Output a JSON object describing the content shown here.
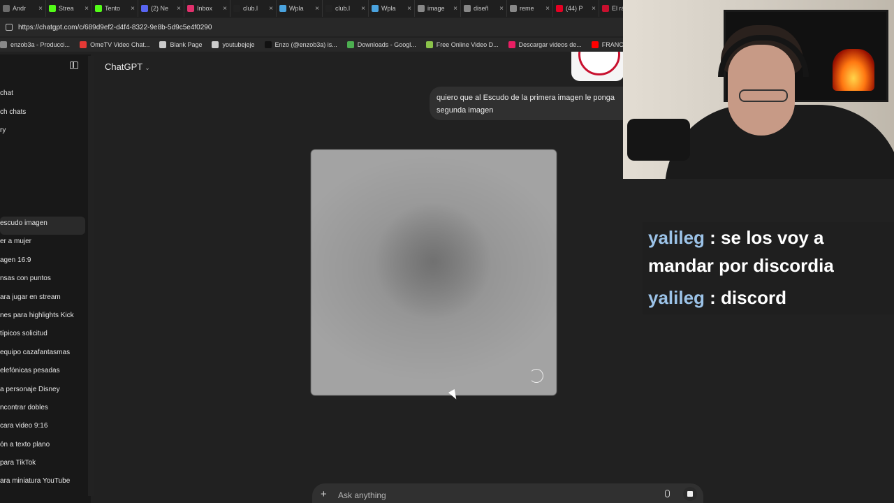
{
  "browser": {
    "tabs": [
      {
        "label": "Andr",
        "color": "#6b6b6b"
      },
      {
        "label": "Strea",
        "color": "#53fc18"
      },
      {
        "label": "Tento",
        "color": "#53fc18"
      },
      {
        "label": "(2) Ne",
        "color": "#5865f2"
      },
      {
        "label": "Inbox",
        "color": "#e1306c"
      },
      {
        "label": "club.l",
        "color": "#222222"
      },
      {
        "label": "Wpla",
        "color": "#4aa3df"
      },
      {
        "label": "club.l",
        "color": "#222222"
      },
      {
        "label": "Wpla",
        "color": "#4aa3df"
      },
      {
        "label": "image",
        "color": "#888888"
      },
      {
        "label": "diseñ",
        "color": "#888888"
      },
      {
        "label": "reme",
        "color": "#888888"
      },
      {
        "label": "(44) P",
        "color": "#e60023"
      },
      {
        "label": "El rá",
        "color": "#c8102e"
      }
    ],
    "url": "https://chatgpt.com/c/689d9ef2-d4f4-8322-9e8b-5d9c5e4f0290",
    "bookmarks": [
      {
        "label": "enzob3a - Producci...",
        "color": "#888888"
      },
      {
        "label": "OmeTV Video Chat...",
        "color": "#e53935"
      },
      {
        "label": "Blank Page",
        "color": "#cccccc"
      },
      {
        "label": "youtubejeje",
        "color": "#cccccc"
      },
      {
        "label": "Enzo (@enzob3a) is...",
        "color": "#111111"
      },
      {
        "label": "Downloads - Googl...",
        "color": "#4caf50"
      },
      {
        "label": "Free Online Video D...",
        "color": "#8bc34a"
      },
      {
        "label": "Descargar videos de...",
        "color": "#e91e63"
      },
      {
        "label": "FRANCIS is a YOUT...",
        "color": "#ff0000"
      }
    ]
  },
  "sidebar": {
    "top_items": [
      "chat",
      "ch chats",
      "ry"
    ],
    "history": [
      "escudo imagen",
      "er a mujer",
      "agen 16:9",
      "nsas con puntos",
      "ara jugar en stream",
      "nes para highlights Kick",
      "típicos solicitud",
      "equipo cazafantasmas",
      "elefónicas pesadas",
      "a personaje Disney",
      "ncontrar dobles",
      "cara video 9:16",
      "ón a texto plano",
      "para TikTok",
      "ara miniatura YouTube"
    ]
  },
  "main": {
    "model_label": "ChatGPT",
    "user_message": "quiero que al Escudo de la primera imagen le ponga segunda imagen",
    "composer_placeholder": "Ask anything"
  },
  "chat_overlay": [
    {
      "user": "yalileg",
      "message": "se los voy a mandar por discordia"
    },
    {
      "user": "yalileg",
      "message": "discord"
    }
  ],
  "colors": {
    "background": "#212121",
    "sidebar": "#181818",
    "bubble": "#303030",
    "chat_username": "#9cc3e8"
  }
}
